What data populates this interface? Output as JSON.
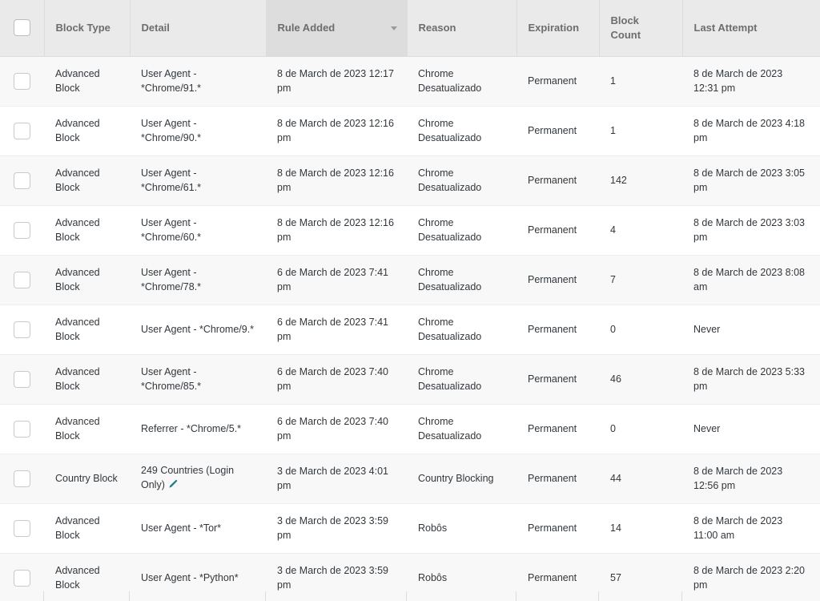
{
  "table": {
    "name": "blocking-rules-table",
    "columns": [
      {
        "key": "check",
        "label": "",
        "sorted": false
      },
      {
        "key": "block_type",
        "label": "Block Type",
        "sorted": false
      },
      {
        "key": "detail",
        "label": "Detail",
        "sorted": false
      },
      {
        "key": "rule_added",
        "label": "Rule Added",
        "sorted": true
      },
      {
        "key": "reason",
        "label": "Reason",
        "sorted": false
      },
      {
        "key": "expiration",
        "label": "Expiration",
        "sorted": false
      },
      {
        "key": "block_count",
        "label": "Block Count",
        "sorted": false
      },
      {
        "key": "last_attempt",
        "label": "Last Attempt",
        "sorted": false
      }
    ],
    "sort_indicator": "chevron-down-icon",
    "select_all_checked": false,
    "rows": [
      {
        "block_type": "Advanced Block",
        "detail": "User Agent - *Chrome/91.*",
        "rule_added": "8 de March de 2023 12:17 pm",
        "reason": "Chrome Desatualizado",
        "expiration": "Permanent",
        "block_count": "1",
        "last_attempt": "8 de March de 2023 12:31 pm",
        "has_edit_icon": false,
        "checked": false
      },
      {
        "block_type": "Advanced Block",
        "detail": "User Agent - *Chrome/90.*",
        "rule_added": "8 de March de 2023 12:16 pm",
        "reason": "Chrome Desatualizado",
        "expiration": "Permanent",
        "block_count": "1",
        "last_attempt": "8 de March de 2023 4:18 pm",
        "has_edit_icon": false,
        "checked": false
      },
      {
        "block_type": "Advanced Block",
        "detail": "User Agent - *Chrome/61.*",
        "rule_added": "8 de March de 2023 12:16 pm",
        "reason": "Chrome Desatualizado",
        "expiration": "Permanent",
        "block_count": "142",
        "last_attempt": "8 de March de 2023 3:05 pm",
        "has_edit_icon": false,
        "checked": false
      },
      {
        "block_type": "Advanced Block",
        "detail": "User Agent - *Chrome/60.*",
        "rule_added": "8 de March de 2023 12:16 pm",
        "reason": "Chrome Desatualizado",
        "expiration": "Permanent",
        "block_count": "4",
        "last_attempt": "8 de March de 2023 3:03 pm",
        "has_edit_icon": false,
        "checked": false
      },
      {
        "block_type": "Advanced Block",
        "detail": "User Agent - *Chrome/78.*",
        "rule_added": "6 de March de 2023 7:41 pm",
        "reason": "Chrome Desatualizado",
        "expiration": "Permanent",
        "block_count": "7",
        "last_attempt": "8 de March de 2023 8:08 am",
        "has_edit_icon": false,
        "checked": false
      },
      {
        "block_type": "Advanced Block",
        "detail": "User Agent - *Chrome/9.*",
        "rule_added": "6 de March de 2023 7:41 pm",
        "reason": "Chrome Desatualizado",
        "expiration": "Permanent",
        "block_count": "0",
        "last_attempt": "Never",
        "has_edit_icon": false,
        "checked": false
      },
      {
        "block_type": "Advanced Block",
        "detail": "User Agent - *Chrome/85.*",
        "rule_added": "6 de March de 2023 7:40 pm",
        "reason": "Chrome Desatualizado",
        "expiration": "Permanent",
        "block_count": "46",
        "last_attempt": "8 de March de 2023 5:33 pm",
        "has_edit_icon": false,
        "checked": false
      },
      {
        "block_type": "Advanced Block",
        "detail": "Referrer - *Chrome/5.*",
        "rule_added": "6 de March de 2023 7:40 pm",
        "reason": "Chrome Desatualizado",
        "expiration": "Permanent",
        "block_count": "0",
        "last_attempt": "Never",
        "has_edit_icon": false,
        "checked": false
      },
      {
        "block_type": "Country Block",
        "detail": "249 Countries (Login Only)",
        "rule_added": "3 de March de 2023 4:01 pm",
        "reason": "Country Blocking",
        "expiration": "Permanent",
        "block_count": "44",
        "last_attempt": "8 de March de 2023 12:56 pm",
        "has_edit_icon": true,
        "edit_icon": "pencil-edit-icon",
        "checked": false
      },
      {
        "block_type": "Advanced Block",
        "detail": "User Agent - *Tor*",
        "rule_added": "3 de March de 2023 3:59 pm",
        "reason": "Robôs",
        "expiration": "Permanent",
        "block_count": "14",
        "last_attempt": "8 de March de 2023 11:00 am",
        "has_edit_icon": false,
        "checked": false
      },
      {
        "block_type": "Advanced Block",
        "detail": "User Agent - *Python*",
        "rule_added": "3 de March de 2023 3:59 pm",
        "reason": "Robôs",
        "expiration": "Permanent",
        "block_count": "57",
        "last_attempt": "8 de March de 2023 2:20 pm",
        "has_edit_icon": false,
        "checked": false
      }
    ]
  },
  "colors": {
    "header_bg": "#eaeaea",
    "header_sorted_bg": "#dddddd",
    "header_text": "#6d6d6d",
    "row_alt_bg": "#f8f8f8",
    "row_bg": "#ffffff",
    "body_text": "#32373c",
    "border": "#ededed",
    "edit_icon": "#2a7d8c"
  }
}
